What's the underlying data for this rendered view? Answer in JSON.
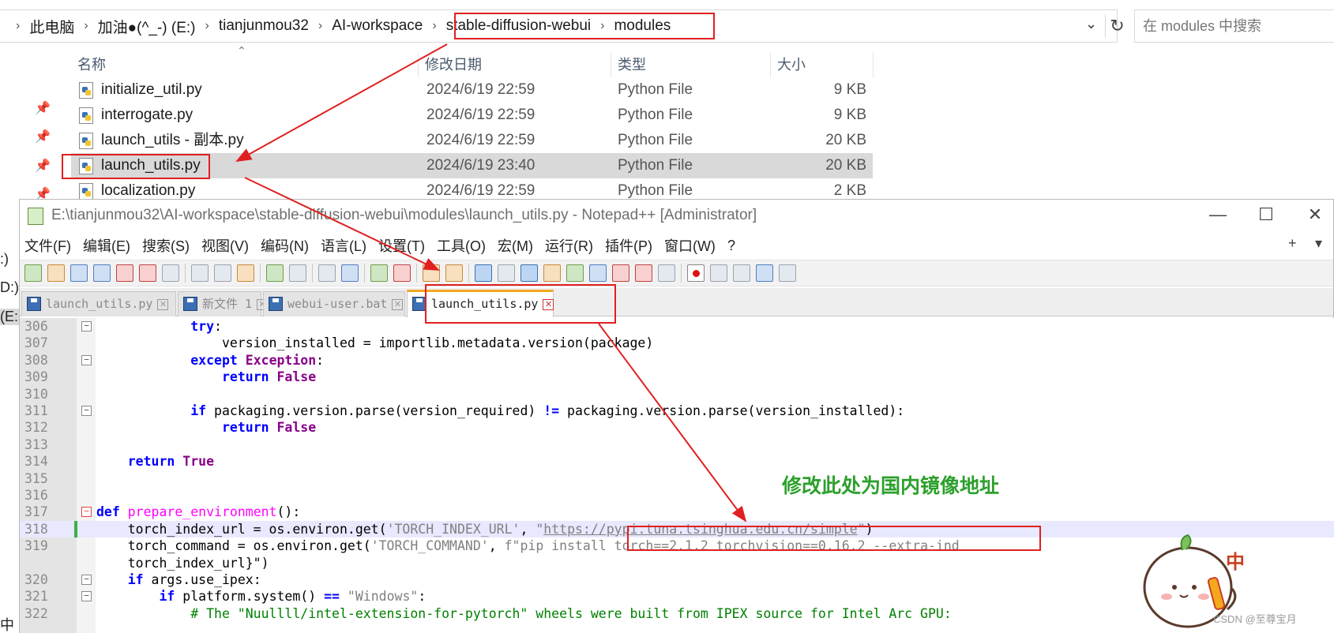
{
  "explorer": {
    "breadcrumb": [
      "此电脑",
      "加油●(^_-) (E:)",
      "tianjunmou32",
      "AI-workspace",
      "stable-diffusion-webui",
      "modules"
    ],
    "search_placeholder": "在 modules 中搜索",
    "columns": {
      "name": "名称",
      "date": "修改日期",
      "type": "类型",
      "size": "大小"
    },
    "files": [
      {
        "name": "initialize_util.py",
        "date": "2024/6/19 22:59",
        "type": "Python File",
        "size": "9 KB"
      },
      {
        "name": "interrogate.py",
        "date": "2024/6/19 22:59",
        "type": "Python File",
        "size": "9 KB"
      },
      {
        "name": "launch_utils - 副本.py",
        "date": "2024/6/19 22:59",
        "type": "Python File",
        "size": "20 KB"
      },
      {
        "name": "launch_utils.py",
        "date": "2024/6/19 23:40",
        "type": "Python File",
        "size": "20 KB"
      },
      {
        "name": "localization.py",
        "date": "2024/6/19 22:59",
        "type": "Python File",
        "size": "2 KB"
      }
    ],
    "left_fragments": [
      ":)",
      "D:)",
      "(E:",
      "中"
    ]
  },
  "notepad": {
    "title": "E:\\tianjunmou32\\AI-workspace\\stable-diffusion-webui\\modules\\launch_utils.py - Notepad++ [Administrator]",
    "window_buttons": {
      "minimize": "—",
      "maximize": "☐",
      "close": "✕"
    },
    "menu": [
      "文件(F)",
      "编辑(E)",
      "搜索(S)",
      "视图(V)",
      "编码(N)",
      "语言(L)",
      "设置(T)",
      "工具(O)",
      "宏(M)",
      "运行(R)",
      "插件(P)",
      "窗口(W)",
      "?"
    ],
    "menu_right": {
      "plus": "+",
      "down": "▾"
    },
    "tabs": [
      {
        "label": "launch_utils.py",
        "active": false
      },
      {
        "label": "新文件 1",
        "active": false
      },
      {
        "label": "webui-user.bat",
        "active": false
      },
      {
        "label": "launch_utils.py",
        "active": true
      }
    ],
    "lines": [
      {
        "n": "306",
        "code": "try:"
      },
      {
        "n": "307",
        "code": "version_installed = importlib.metadata.version(package)"
      },
      {
        "n": "308",
        "code": "except Exception:"
      },
      {
        "n": "309",
        "code": "return False"
      },
      {
        "n": "310",
        "code": ""
      },
      {
        "n": "311",
        "code": "if packaging.version.parse(version_required) != packaging.version.parse(version_installed):"
      },
      {
        "n": "312",
        "code": "return False"
      },
      {
        "n": "313",
        "code": ""
      },
      {
        "n": "314",
        "code": "return True"
      },
      {
        "n": "315",
        "code": ""
      },
      {
        "n": "316",
        "code": ""
      },
      {
        "n": "317",
        "code": "def prepare_environment():"
      },
      {
        "n": "318",
        "code": "torch_index_url = os.environ.get('TORCH_INDEX_URL', \"https://pypi.tuna.tsinghua.edu.cn/simple\")"
      },
      {
        "n": "319",
        "code": "torch_command = os.environ.get('TORCH_COMMAND', f\"pip install torch==2.1.2 torchvision==0.16.2 --extra-ind"
      },
      {
        "n": "",
        "code": "torch_index_url}\")"
      },
      {
        "n": "320",
        "code": "if args.use_ipex:"
      },
      {
        "n": "321",
        "code": "if platform.system() == \"Windows\":"
      },
      {
        "n": "322",
        "code": "# The \"Nuullll/intel-extension-for-pytorch\" wheels were built from IPEX source for Intel Arc GPU:"
      }
    ]
  },
  "annotation": {
    "text": "修改此处为国内镜像地址",
    "color": "#2ca02c",
    "box_color": "#e02020"
  },
  "watermark": "CSDN @至尊宝月",
  "mascot_glyph": "中"
}
